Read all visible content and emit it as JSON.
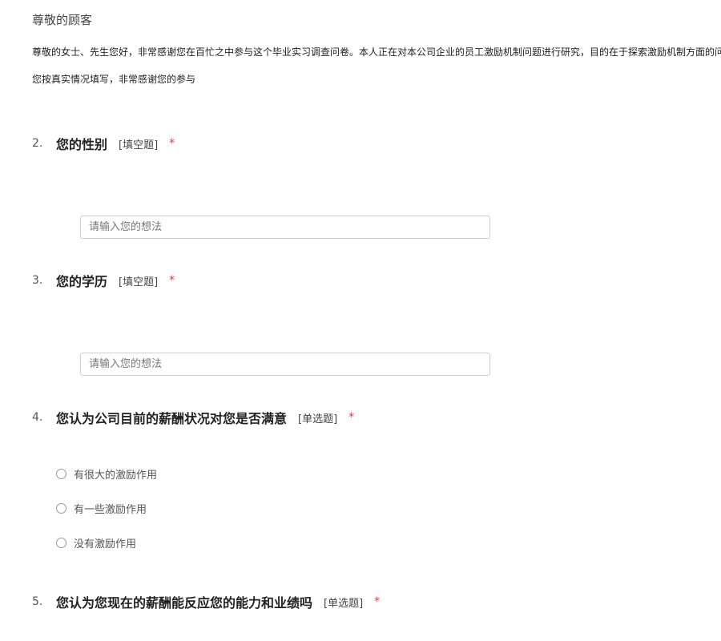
{
  "survey": {
    "greeting": "尊敬的顾客",
    "intro_line1": "尊敬的女士、先生您好，非常感谢您在百忙之中参与这个毕业实习调查问卷。本人正在对本公司企业的员工激励机制问题进行研究，目的在于探索激励机制方面的问",
    "intro_line2": "您按真实情况填写，非常感谢您的参与"
  },
  "questions": [
    {
      "number": "2.",
      "title": "您的性别",
      "type": "[填空题]",
      "required": "*",
      "input_placeholder": "请输入您的想法",
      "input_value": ""
    },
    {
      "number": "3.",
      "title": "您的学历",
      "type": "[填空题]",
      "required": "*",
      "input_placeholder": "请输入您的想法",
      "input_value": ""
    },
    {
      "number": "4.",
      "title": "您认为公司目前的薪酬状况对您是否满意",
      "type": "[单选题]",
      "required": "*",
      "options": [
        "有很大的激励作用",
        "有一些激励作用",
        "没有激励作用"
      ]
    },
    {
      "number": "5.",
      "title": "您认为您现在的薪酬能反应您的能力和业绩吗",
      "type": "[单选题]",
      "required": "*"
    }
  ],
  "colors": {
    "required_mark": "#e4393c",
    "input_border": "#cfcfcf",
    "radio_border": "#9a9a9a"
  }
}
